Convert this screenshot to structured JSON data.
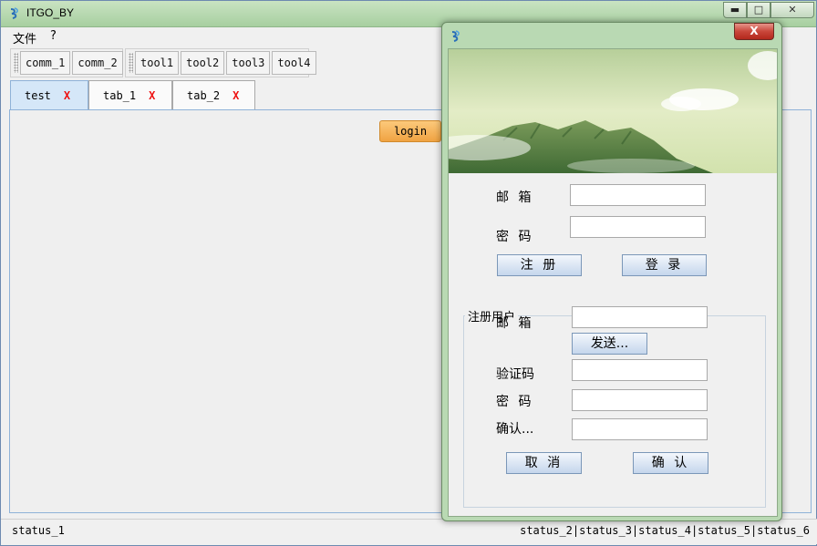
{
  "window": {
    "title": "ITGO_BY",
    "controls": {
      "minimize": "▬",
      "maximize": "□",
      "close": "✕"
    }
  },
  "menu": {
    "items": [
      "文件",
      "?"
    ]
  },
  "toolbar1": {
    "buttons": [
      "comm_1",
      "comm_2"
    ]
  },
  "toolbar2": {
    "buttons": [
      "tool1",
      "tool2",
      "tool3",
      "tool4"
    ]
  },
  "tabs": [
    {
      "label": "test",
      "close": "X"
    },
    {
      "label": "tab_1",
      "close": "X"
    },
    {
      "label": "tab_2",
      "close": "X"
    }
  ],
  "content": {
    "login_label": "login"
  },
  "status": {
    "left": "status_1",
    "right": "status_2|status_3|status_4|status_5|status_6"
  },
  "dialog": {
    "close": "X",
    "login": {
      "email_label": "邮 箱",
      "email_value": "",
      "password_label": "密 码",
      "password_value": "",
      "register_button": "注 册",
      "login_button": "登 录"
    },
    "register": {
      "group_title": "注册用户",
      "email_label": "邮 箱",
      "email_value": "",
      "send_button": "发送...",
      "code_label": "验证码",
      "code_value": "",
      "password_label": "密 码",
      "password_value": "",
      "confirm_label": "确认...",
      "confirm_value": "",
      "cancel_button": "取 消",
      "ok_button": "确 认"
    }
  },
  "colors": {
    "accent_tab": "#d5e7f8",
    "login_button": "#f0a342",
    "tab_close": "#ee1111",
    "dialog_frame": "#b9d9b3"
  }
}
